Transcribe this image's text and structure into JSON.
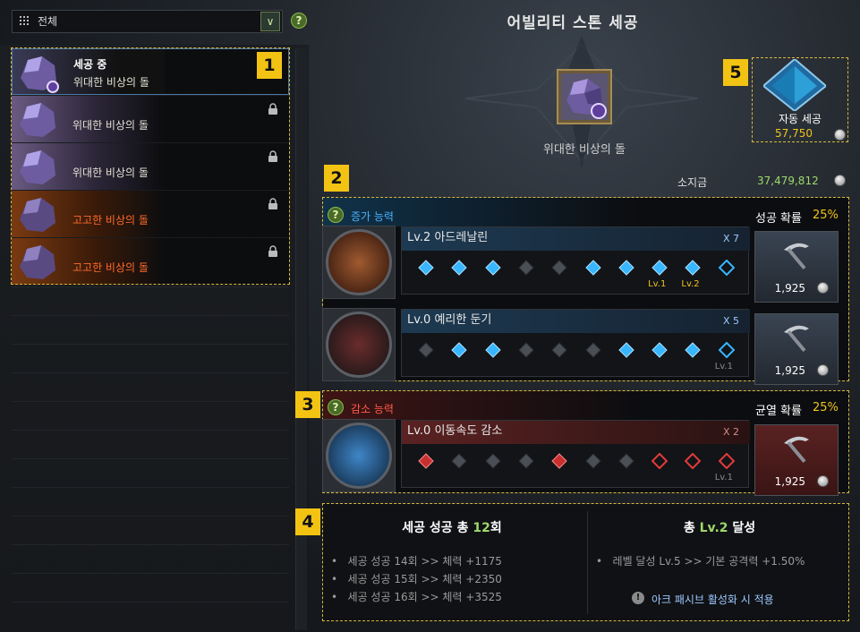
{
  "filter": {
    "value": "전체",
    "dropdown_glyph": "∨"
  },
  "list": {
    "items": [
      {
        "status": "세공 중",
        "name": "위대한 비상의 돌",
        "tier": "epic",
        "selected": true
      },
      {
        "status": "",
        "name": "위대한 비상의 돌",
        "tier": "epic",
        "selected": false
      },
      {
        "status": "",
        "name": "위대한 비상의 돌",
        "tier": "epic",
        "selected": false
      },
      {
        "status": "",
        "name": "고고한 비상의 돌",
        "tier": "legendary",
        "selected": false
      },
      {
        "status": "",
        "name": "고고한 비상의 돌",
        "tier": "legendary",
        "selected": false
      }
    ]
  },
  "badges": [
    "1",
    "2",
    "3",
    "4",
    "5"
  ],
  "title": "어빌리티 스톤 세공",
  "stone": {
    "name": "위대한 비상의 돌"
  },
  "auto": {
    "label": "자동 세공",
    "cost": "57,750"
  },
  "money": {
    "label": "소지금",
    "value": "37,479,812"
  },
  "increase": {
    "header": "증가 능력",
    "rate_label": "성공 확률",
    "rate": "25%",
    "lines": [
      {
        "name": "Lv.2 아드레날린",
        "count": "X 7",
        "slots": [
          "s",
          "s",
          "s",
          "f",
          "f",
          "s",
          "s",
          "s",
          "s",
          "e"
        ],
        "tags": [
          "",
          "",
          "",
          "",
          "",
          "",
          "",
          "Lv.1",
          "Lv.2",
          ""
        ],
        "cost": "1,925"
      },
      {
        "name": "Lv.0 예리한 둔기",
        "count": "X 5",
        "slots": [
          "f",
          "s",
          "s",
          "f",
          "f",
          "f",
          "s",
          "s",
          "s",
          "e"
        ],
        "tags": [
          "",
          "",
          "",
          "",
          "",
          "",
          "",
          "",
          "",
          "Lv.1"
        ],
        "cost": "1,925"
      }
    ]
  },
  "decrease": {
    "header": "감소 능력",
    "rate_label": "균열 확률",
    "rate": "25%",
    "lines": [
      {
        "name": "Lv.0 이동속도 감소",
        "count": "X 2",
        "slots": [
          "r",
          "f",
          "f",
          "f",
          "r",
          "f",
          "f",
          "e",
          "e",
          "e"
        ],
        "tags": [
          "",
          "",
          "",
          "",
          "",
          "",
          "",
          "",
          "",
          "Lv.1"
        ],
        "cost": "1,925"
      }
    ]
  },
  "summary": {
    "left_title": {
      "a": "세공 성공 총 ",
      "b": "12",
      "c": "회"
    },
    "left_items": [
      "세공 성공 14회 >> 체력 +1175",
      "세공 성공 15회 >> 체력 +2350",
      "세공 성공 16회 >> 체력 +3525"
    ],
    "right_title": {
      "a": "총 ",
      "b": "Lv.2",
      "c": " 달성"
    },
    "right_items": [
      "레벨 달성 Lv.5 >> 기본 공격력 +1.50%"
    ],
    "note": "아크 패시브 활성화 시 적용"
  },
  "colors": {
    "accent_yellow": "#f3c314",
    "success": "#f0c419",
    "blue": "#38b6ff",
    "red": "#e23b3b",
    "green": "#9ed86a"
  }
}
